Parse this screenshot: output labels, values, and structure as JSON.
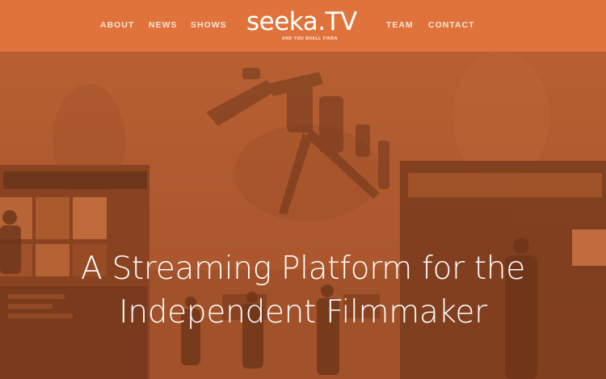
{
  "header": {
    "nav_left": [
      "ABOUT",
      "NEWS",
      "SHOWS"
    ],
    "nav_right": [
      "TEAM",
      "CONTACT"
    ],
    "logo": {
      "wordmark": "seeka.TV",
      "tagline": "AND YOU SHALL FINDA"
    }
  },
  "hero": {
    "headline_line1": "A Streaming Platform for the",
    "headline_line2": "Independent Filmmaker"
  },
  "colors": {
    "header_bg": "#e0733b",
    "overlay": "#a9582f",
    "text": "#ffffff"
  }
}
